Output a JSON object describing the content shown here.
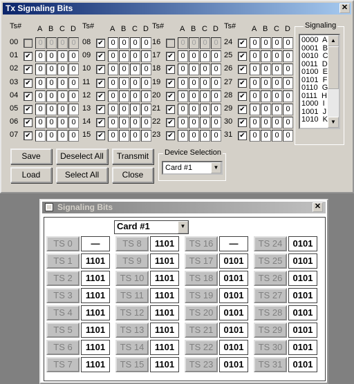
{
  "window1": {
    "title": "Tx Signaling Bits",
    "column_header_ts": "Ts#",
    "bit_labels": [
      "A",
      "B",
      "C",
      "D"
    ],
    "groups": [
      {
        "slots": [
          {
            "num": "00",
            "checked": false,
            "bits": [
              "0",
              "0",
              "0",
              "0"
            ],
            "disabled": true
          },
          {
            "num": "01",
            "checked": true,
            "bits": [
              "0",
              "0",
              "0",
              "0"
            ],
            "disabled": false
          },
          {
            "num": "02",
            "checked": true,
            "bits": [
              "0",
              "0",
              "0",
              "0"
            ],
            "disabled": false
          },
          {
            "num": "03",
            "checked": true,
            "bits": [
              "0",
              "0",
              "0",
              "0"
            ],
            "disabled": false
          },
          {
            "num": "04",
            "checked": true,
            "bits": [
              "0",
              "0",
              "0",
              "0"
            ],
            "disabled": false
          },
          {
            "num": "05",
            "checked": true,
            "bits": [
              "0",
              "0",
              "0",
              "0"
            ],
            "disabled": false
          },
          {
            "num": "06",
            "checked": true,
            "bits": [
              "0",
              "0",
              "0",
              "0"
            ],
            "disabled": false
          },
          {
            "num": "07",
            "checked": true,
            "bits": [
              "0",
              "0",
              "0",
              "0"
            ],
            "disabled": false
          }
        ]
      },
      {
        "slots": [
          {
            "num": "08",
            "checked": true,
            "bits": [
              "0",
              "0",
              "0",
              "0"
            ],
            "disabled": false
          },
          {
            "num": "09",
            "checked": true,
            "bits": [
              "0",
              "0",
              "0",
              "0"
            ],
            "disabled": false
          },
          {
            "num": "10",
            "checked": true,
            "bits": [
              "0",
              "0",
              "0",
              "0"
            ],
            "disabled": false
          },
          {
            "num": "11",
            "checked": true,
            "bits": [
              "0",
              "0",
              "0",
              "0"
            ],
            "disabled": false
          },
          {
            "num": "12",
            "checked": true,
            "bits": [
              "0",
              "0",
              "0",
              "0"
            ],
            "disabled": false
          },
          {
            "num": "13",
            "checked": true,
            "bits": [
              "0",
              "0",
              "0",
              "0"
            ],
            "disabled": false
          },
          {
            "num": "14",
            "checked": true,
            "bits": [
              "0",
              "0",
              "0",
              "0"
            ],
            "disabled": false
          },
          {
            "num": "15",
            "checked": true,
            "bits": [
              "0",
              "0",
              "0",
              "0"
            ],
            "disabled": false
          }
        ]
      },
      {
        "slots": [
          {
            "num": "16",
            "checked": false,
            "bits": [
              "0",
              "0",
              "0",
              "0"
            ],
            "disabled": true
          },
          {
            "num": "17",
            "checked": true,
            "bits": [
              "0",
              "0",
              "0",
              "0"
            ],
            "disabled": false
          },
          {
            "num": "18",
            "checked": true,
            "bits": [
              "0",
              "0",
              "0",
              "0"
            ],
            "disabled": false
          },
          {
            "num": "19",
            "checked": true,
            "bits": [
              "0",
              "0",
              "0",
              "0"
            ],
            "disabled": false
          },
          {
            "num": "20",
            "checked": true,
            "bits": [
              "0",
              "0",
              "0",
              "0"
            ],
            "disabled": false
          },
          {
            "num": "21",
            "checked": true,
            "bits": [
              "0",
              "0",
              "0",
              "0"
            ],
            "disabled": false
          },
          {
            "num": "22",
            "checked": true,
            "bits": [
              "0",
              "0",
              "0",
              "0"
            ],
            "disabled": false
          },
          {
            "num": "23",
            "checked": true,
            "bits": [
              "0",
              "0",
              "0",
              "0"
            ],
            "disabled": false
          }
        ]
      },
      {
        "slots": [
          {
            "num": "24",
            "checked": true,
            "bits": [
              "0",
              "0",
              "0",
              "0"
            ],
            "disabled": false
          },
          {
            "num": "25",
            "checked": true,
            "bits": [
              "0",
              "0",
              "0",
              "0"
            ],
            "disabled": false
          },
          {
            "num": "26",
            "checked": true,
            "bits": [
              "0",
              "0",
              "0",
              "0"
            ],
            "disabled": false
          },
          {
            "num": "27",
            "checked": true,
            "bits": [
              "0",
              "0",
              "0",
              "0"
            ],
            "disabled": false
          },
          {
            "num": "28",
            "checked": true,
            "bits": [
              "0",
              "0",
              "0",
              "0"
            ],
            "disabled": false
          },
          {
            "num": "29",
            "checked": true,
            "bits": [
              "0",
              "0",
              "0",
              "0"
            ],
            "disabled": false
          },
          {
            "num": "30",
            "checked": true,
            "bits": [
              "0",
              "0",
              "0",
              "0"
            ],
            "disabled": false
          },
          {
            "num": "31",
            "checked": true,
            "bits": [
              "0",
              "0",
              "0",
              "0"
            ],
            "disabled": false
          }
        ]
      }
    ],
    "signaling": {
      "label": "Signaling",
      "items": [
        "0000  A",
        "0001  B",
        "0010  C",
        "0011  D",
        "0100  E",
        "0101  F",
        "0110  G",
        "0111  H",
        "1000  I",
        "1001  J",
        "1010  K"
      ]
    },
    "buttons": {
      "save": "Save",
      "deselect_all": "Deselect All",
      "transmit": "Transmit",
      "load": "Load",
      "select_all": "Select All",
      "close": "Close"
    },
    "device_selection": {
      "label": "Device Selection",
      "value": "Card #1"
    }
  },
  "window2": {
    "title": "Signaling Bits",
    "card_select": "Card #1",
    "slots": [
      {
        "label": "TS 0",
        "value": "—"
      },
      {
        "label": "TS 1",
        "value": "1101"
      },
      {
        "label": "TS 2",
        "value": "1101"
      },
      {
        "label": "TS 3",
        "value": "1101"
      },
      {
        "label": "TS 4",
        "value": "1101"
      },
      {
        "label": "TS 5",
        "value": "1101"
      },
      {
        "label": "TS 6",
        "value": "1101"
      },
      {
        "label": "TS 7",
        "value": "1101"
      },
      {
        "label": "TS 8",
        "value": "1101"
      },
      {
        "label": "TS 9",
        "value": "1101"
      },
      {
        "label": "TS 10",
        "value": "1101"
      },
      {
        "label": "TS 11",
        "value": "1101"
      },
      {
        "label": "TS 12",
        "value": "1101"
      },
      {
        "label": "TS 13",
        "value": "1101"
      },
      {
        "label": "TS 14",
        "value": "1101"
      },
      {
        "label": "TS 15",
        "value": "1101"
      },
      {
        "label": "TS 16",
        "value": "—"
      },
      {
        "label": "TS 17",
        "value": "0101"
      },
      {
        "label": "TS 18",
        "value": "0101"
      },
      {
        "label": "TS 19",
        "value": "0101"
      },
      {
        "label": "TS 20",
        "value": "0101"
      },
      {
        "label": "TS 21",
        "value": "0101"
      },
      {
        "label": "TS 22",
        "value": "0101"
      },
      {
        "label": "TS 23",
        "value": "0101"
      },
      {
        "label": "TS 24",
        "value": "0101"
      },
      {
        "label": "TS 25",
        "value": "0101"
      },
      {
        "label": "TS 26",
        "value": "0101"
      },
      {
        "label": "TS 27",
        "value": "0101"
      },
      {
        "label": "TS 28",
        "value": "0101"
      },
      {
        "label": "TS 29",
        "value": "0101"
      },
      {
        "label": "TS 30",
        "value": "0101"
      },
      {
        "label": "TS 31",
        "value": "0101"
      }
    ]
  }
}
